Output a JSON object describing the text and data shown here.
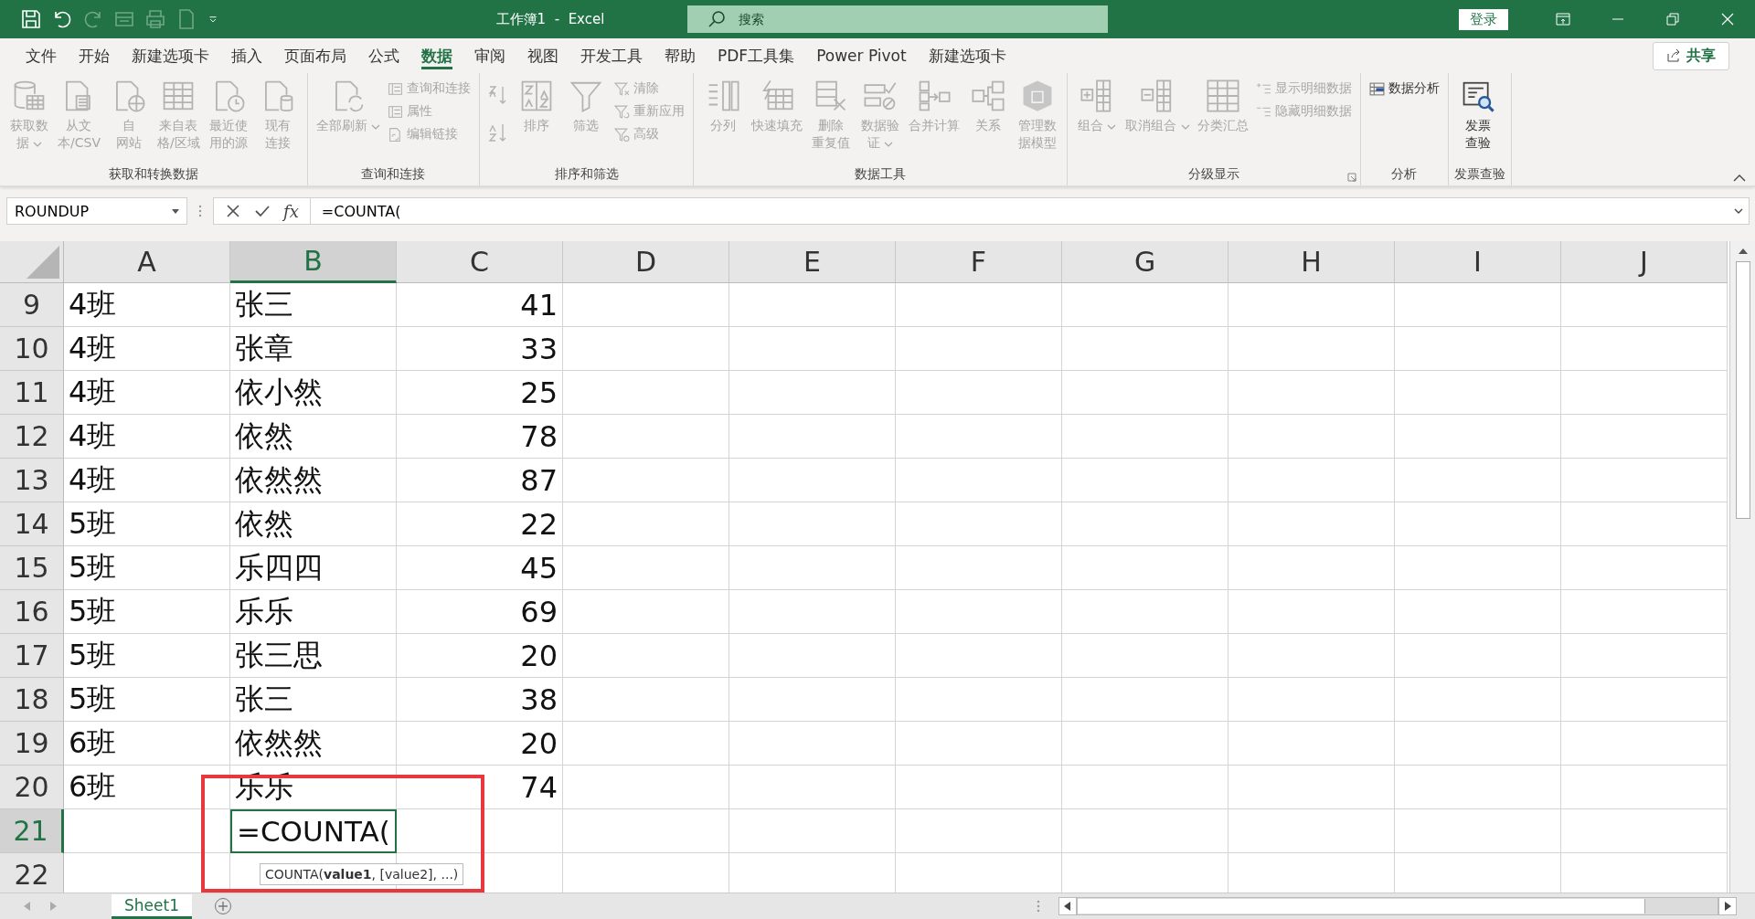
{
  "title_bar": {
    "title": "工作簿1  -  Excel",
    "search": {
      "placeholder": "搜索"
    },
    "login": "登录"
  },
  "menu": {
    "tabs": [
      {
        "label": "文件",
        "selected": false
      },
      {
        "label": "开始",
        "selected": false
      },
      {
        "label": "新建选项卡",
        "selected": false
      },
      {
        "label": "插入",
        "selected": false
      },
      {
        "label": "页面布局",
        "selected": false
      },
      {
        "label": "公式",
        "selected": false
      },
      {
        "label": "数据",
        "selected": true
      },
      {
        "label": "审阅",
        "selected": false
      },
      {
        "label": "视图",
        "selected": false
      },
      {
        "label": "开发工具",
        "selected": false
      },
      {
        "label": "帮助",
        "selected": false
      },
      {
        "label": "PDF工具集",
        "selected": false
      },
      {
        "label": "Power Pivot",
        "selected": false
      },
      {
        "label": "新建选项卡",
        "selected": false
      }
    ],
    "share": "共享"
  },
  "ribbon": {
    "groups": [
      {
        "label": "获取和转换数据",
        "items": [
          {
            "kind": "large",
            "lines": [
              "获取数",
              "据"
            ],
            "dropdown": true,
            "disabled": true
          },
          {
            "kind": "large",
            "lines": [
              "从文",
              "本/CSV"
            ],
            "dropdown": false,
            "disabled": true
          },
          {
            "kind": "large",
            "lines": [
              "自",
              "网站"
            ],
            "dropdown": false,
            "disabled": true
          },
          {
            "kind": "large",
            "lines": [
              "来自表",
              "格/区域"
            ],
            "dropdown": false,
            "disabled": true
          },
          {
            "kind": "large",
            "lines": [
              "最近使",
              "用的源"
            ],
            "dropdown": false,
            "disabled": true
          },
          {
            "kind": "large",
            "lines": [
              "现有",
              "连接"
            ],
            "dropdown": false,
            "disabled": true
          }
        ]
      },
      {
        "label": "查询和连接",
        "items": [
          {
            "kind": "large",
            "lines": [
              "全部刷新"
            ],
            "dropdown": true,
            "disabled": true
          },
          {
            "kind": "small",
            "lines": [
              "查询和连接"
            ],
            "disabled": true
          },
          {
            "kind": "small",
            "lines": [
              "属性"
            ],
            "disabled": true
          },
          {
            "kind": "small",
            "lines": [
              "编辑链接"
            ],
            "disabled": true
          }
        ]
      },
      {
        "label": "排序和筛选",
        "items": [
          {
            "kind": "icon",
            "disabled": true
          },
          {
            "kind": "icon",
            "disabled": true
          },
          {
            "kind": "large",
            "lines": [
              "排序"
            ],
            "dropdown": false,
            "disabled": true
          },
          {
            "kind": "large",
            "lines": [
              "筛选"
            ],
            "dropdown": false,
            "disabled": true
          },
          {
            "kind": "small",
            "lines": [
              "清除"
            ],
            "disabled": true
          },
          {
            "kind": "small",
            "lines": [
              "重新应用"
            ],
            "disabled": true
          },
          {
            "kind": "small",
            "lines": [
              "高级"
            ],
            "disabled": true
          }
        ]
      },
      {
        "label": "数据工具",
        "items": [
          {
            "kind": "large",
            "lines": [
              "分列"
            ],
            "dropdown": false,
            "disabled": true
          },
          {
            "kind": "large",
            "lines": [
              "快速填充"
            ],
            "dropdown": false,
            "disabled": true
          },
          {
            "kind": "large",
            "lines": [
              "删除",
              "重复值"
            ],
            "dropdown": false,
            "disabled": true
          },
          {
            "kind": "large",
            "lines": [
              "数据验",
              "证"
            ],
            "dropdown": true,
            "disabled": true
          },
          {
            "kind": "large",
            "lines": [
              "合并计算"
            ],
            "dropdown": false,
            "disabled": true
          },
          {
            "kind": "large",
            "lines": [
              "关系"
            ],
            "dropdown": false,
            "disabled": true
          },
          {
            "kind": "large",
            "lines": [
              "管理数",
              "据模型"
            ],
            "dropdown": false,
            "disabled": true
          }
        ]
      },
      {
        "label": "分级显示",
        "launcher": true,
        "items": [
          {
            "kind": "large",
            "lines": [
              "组合"
            ],
            "dropdown": true,
            "disabled": true
          },
          {
            "kind": "large",
            "lines": [
              "取消组合"
            ],
            "dropdown": true,
            "disabled": true
          },
          {
            "kind": "large",
            "lines": [
              "分类汇总"
            ],
            "dropdown": false,
            "disabled": true
          },
          {
            "kind": "small",
            "lines": [
              "显示明细数据"
            ],
            "disabled": true
          },
          {
            "kind": "small",
            "lines": [
              "隐藏明细数据"
            ],
            "disabled": true
          }
        ]
      },
      {
        "label": "分析",
        "items": [
          {
            "kind": "small",
            "lines": [
              "数据分析"
            ],
            "disabled": false
          }
        ]
      },
      {
        "label": "发票查验",
        "items": [
          {
            "kind": "large",
            "lines": [
              "发票",
              "查验"
            ],
            "dropdown": false,
            "disabled": false
          }
        ]
      }
    ]
  },
  "formula_bar": {
    "name_box": "ROUNDUP",
    "fx": "fx",
    "formula": "=COUNTA("
  },
  "sheet": {
    "columns": [
      {
        "label": "A",
        "selected": false
      },
      {
        "label": "B",
        "selected": true
      },
      {
        "label": "C",
        "selected": false
      },
      {
        "label": "D",
        "selected": false
      },
      {
        "label": "E",
        "selected": false
      },
      {
        "label": "F",
        "selected": false
      },
      {
        "label": "G",
        "selected": false
      },
      {
        "label": "H",
        "selected": false
      },
      {
        "label": "I",
        "selected": false
      },
      {
        "label": "J",
        "selected": false
      }
    ],
    "rows": [
      {
        "number": "9",
        "selected": false,
        "class": "4班",
        "name": "张三",
        "score": "41"
      },
      {
        "number": "10",
        "selected": false,
        "class": "4班",
        "name": "张章",
        "score": "33"
      },
      {
        "number": "11",
        "selected": false,
        "class": "4班",
        "name": "依小然",
        "score": "25"
      },
      {
        "number": "12",
        "selected": false,
        "class": "4班",
        "name": "依然",
        "score": "78"
      },
      {
        "number": "13",
        "selected": false,
        "class": "4班",
        "name": "依然然",
        "score": "87"
      },
      {
        "number": "14",
        "selected": false,
        "class": "5班",
        "name": "依然",
        "score": "22"
      },
      {
        "number": "15",
        "selected": false,
        "class": "5班",
        "name": "乐四四",
        "score": "45"
      },
      {
        "number": "16",
        "selected": false,
        "class": "5班",
        "name": "乐乐",
        "score": "69"
      },
      {
        "number": "17",
        "selected": false,
        "class": "5班",
        "name": "张三思",
        "score": "20"
      },
      {
        "number": "18",
        "selected": false,
        "class": "5班",
        "name": "张三",
        "score": "38"
      },
      {
        "number": "19",
        "selected": false,
        "class": "6班",
        "name": "依然然",
        "score": "20"
      },
      {
        "number": "20",
        "selected": false,
        "class": "6班",
        "name": "乐乐",
        "score": "74"
      },
      {
        "number": "21",
        "selected": true,
        "editing": "=COUNTA("
      },
      {
        "number": "22",
        "selected": false
      }
    ],
    "tooltip": "COUNTA(**value1**, [value2], ...)"
  },
  "sheet_tabs": [
    {
      "label": "Sheet1",
      "selected": true
    }
  ]
}
